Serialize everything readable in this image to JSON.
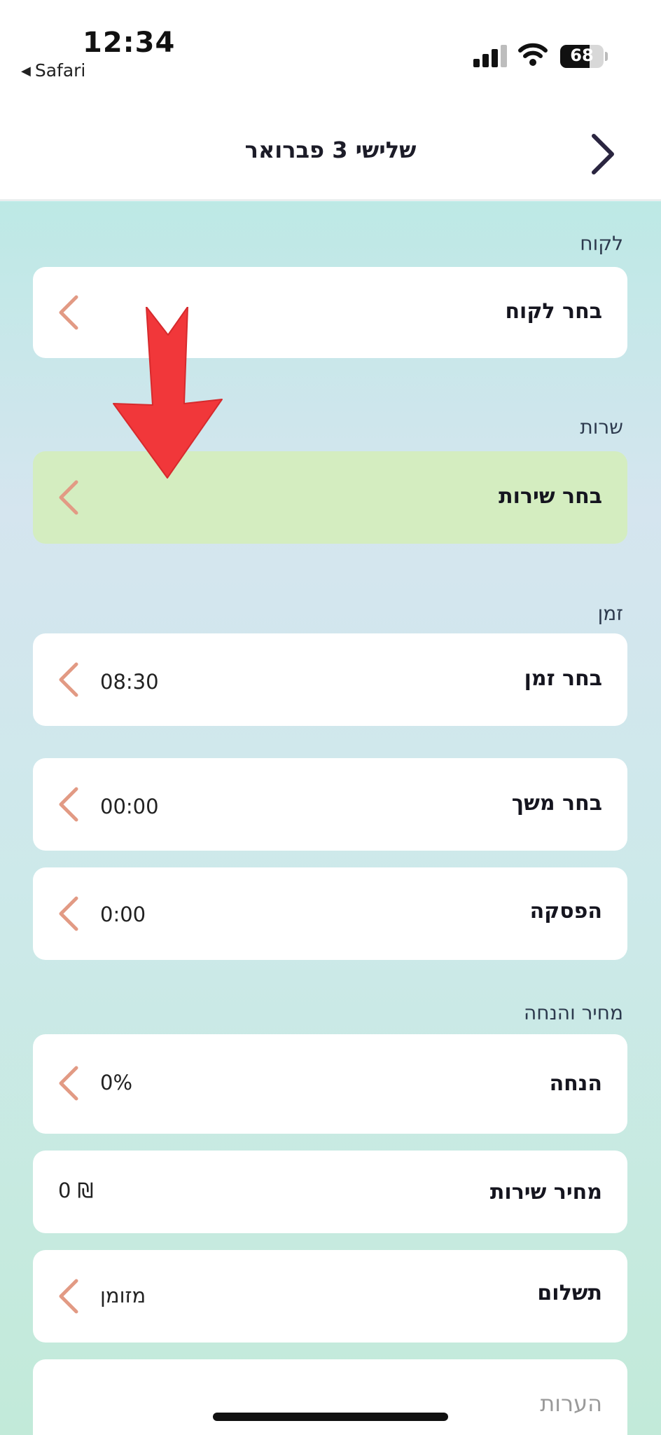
{
  "status_bar": {
    "time": "12:34",
    "back_app": "Safari",
    "back_icon": "back-triangle-icon",
    "battery_percent": "68",
    "battery_level": 0.68,
    "signal_icon": "cellular-signal-icon",
    "wifi_icon": "wifi-icon"
  },
  "nav": {
    "title": "שלישי 3 פברואר",
    "forward_icon": "chevron-right-icon"
  },
  "sections": {
    "customer": "לקוח",
    "service": "שרות",
    "time": "זמן",
    "price": "מחיר והנחה"
  },
  "rows": {
    "customer": {
      "label": "בחר לקוח"
    },
    "service": {
      "label": "בחר שירות"
    },
    "time": {
      "label": "בחר זמן",
      "value": "08:30"
    },
    "duration": {
      "label": "בחר משך",
      "value": "00:00"
    },
    "break": {
      "label": "הפסקה",
      "value": "0:00"
    },
    "discount": {
      "label": "הנחה",
      "value": "0%"
    },
    "service_price": {
      "label": "מחיר שירות",
      "value": "₪ 0"
    },
    "payment": {
      "label": "תשלום",
      "value": "מזומן"
    }
  },
  "notes": {
    "placeholder": "הערות"
  },
  "colors": {
    "highlight": "#d4edc0",
    "chevron": "#e29a84",
    "arrow": "#f1373a",
    "nav_icon": "#2a2540"
  },
  "overlay": {
    "icon": "red-down-arrow-icon"
  }
}
